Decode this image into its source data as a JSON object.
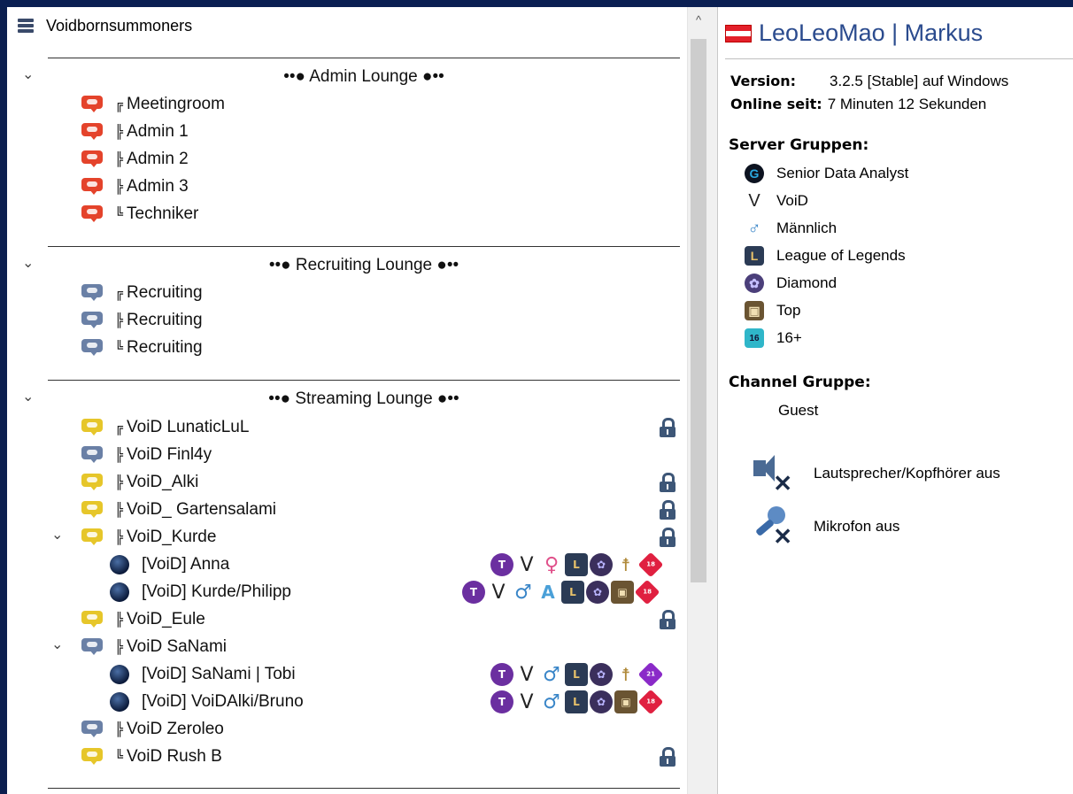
{
  "server": {
    "name": "Voidbornsummoners"
  },
  "lounges": [
    {
      "title": "••● Admin Lounge ●••",
      "channels": [
        {
          "prefix": "╔",
          "name": "Meetingroom",
          "color": "#e4432b"
        },
        {
          "prefix": "╠",
          "name": "Admin 1",
          "color": "#e4432b"
        },
        {
          "prefix": "╠",
          "name": "Admin 2",
          "color": "#e4432b"
        },
        {
          "prefix": "╠",
          "name": "Admin 3",
          "color": "#e4432b"
        },
        {
          "prefix": "╚",
          "name": "Techniker",
          "color": "#e4432b"
        }
      ]
    },
    {
      "title": "••● Recruiting Lounge ●••",
      "channels": [
        {
          "prefix": "╔",
          "name": "Recruiting",
          "color": "#6a80a6"
        },
        {
          "prefix": "╠",
          "name": "Recruiting",
          "color": "#6a80a6"
        },
        {
          "prefix": "╚",
          "name": "Recruiting",
          "color": "#6a80a6"
        }
      ]
    },
    {
      "title": "••● Streaming Lounge ●••",
      "channels": [
        {
          "prefix": "╔",
          "name": "VoiD LunaticLuL",
          "color": "#e6c62a",
          "locked": true
        },
        {
          "prefix": "╠",
          "name": "VoiD Finl4y",
          "color": "#6a80a6"
        },
        {
          "prefix": "╠",
          "name": "VoiD_Alki",
          "color": "#e6c62a",
          "locked": true
        },
        {
          "prefix": "╠",
          "name": "VoiD_ Gartensalami",
          "color": "#e6c62a",
          "locked": true
        },
        {
          "prefix": "╠",
          "name": "VoiD_Kurde",
          "color": "#e6c62a",
          "locked": true
        },
        {
          "user": "[VoiD] Anna"
        },
        {
          "user": "[VoiD] Kurde/Philipp"
        },
        {
          "prefix": "╠",
          "name": "VoiD_Eule",
          "color": "#e6c62a",
          "locked": true
        },
        {
          "prefix": "╠",
          "name": "VoiD SaNami",
          "color": "#6a80a6"
        },
        {
          "user": "[VoiD] SaNami | Tobi"
        },
        {
          "user": "[VoiD] VoiDAlki/Bruno"
        },
        {
          "prefix": "╠",
          "name": "VoiD Zeroleo",
          "color": "#6a80a6"
        },
        {
          "prefix": "╚",
          "name": "VoiD Rush B",
          "color": "#e6c62a",
          "locked": true
        }
      ]
    }
  ],
  "badges": {
    "twitch": "T",
    "void": "V",
    "female": "♀",
    "male": "♂",
    "arrow": "A",
    "lol": "L",
    "diamond": "✿",
    "support": "☨",
    "top": "▣",
    "age18": "18",
    "age21": "21"
  },
  "info": {
    "title": "LeoLeoMao | Markus",
    "version_label": "Version:",
    "version_value": "3.2.5 [Stable] auf Windows",
    "online_label": "Online seit:",
    "online_value": "7 Minuten 12 Sekunden",
    "server_groups_label": "Server Gruppen:",
    "server_groups": [
      {
        "icon": "G",
        "label": "Senior Data Analyst"
      },
      {
        "icon": "V",
        "label": "VoiD"
      },
      {
        "icon": "♂",
        "label": "Männlich"
      },
      {
        "icon": "L",
        "label": "League of Legends"
      },
      {
        "icon": "✿",
        "label": "Diamond"
      },
      {
        "icon": "▣",
        "label": "Top"
      },
      {
        "icon": "16",
        "label": "16+"
      }
    ],
    "channel_group_label": "Channel Gruppe:",
    "channel_group_value": "Guest",
    "speaker_status": "Lautsprecher/Kopfhörer aus",
    "mic_status": "Mikrofon aus"
  },
  "ui": {
    "scroll_up": "^",
    "chevron": "⌄",
    "chevron_open": "⌄"
  }
}
